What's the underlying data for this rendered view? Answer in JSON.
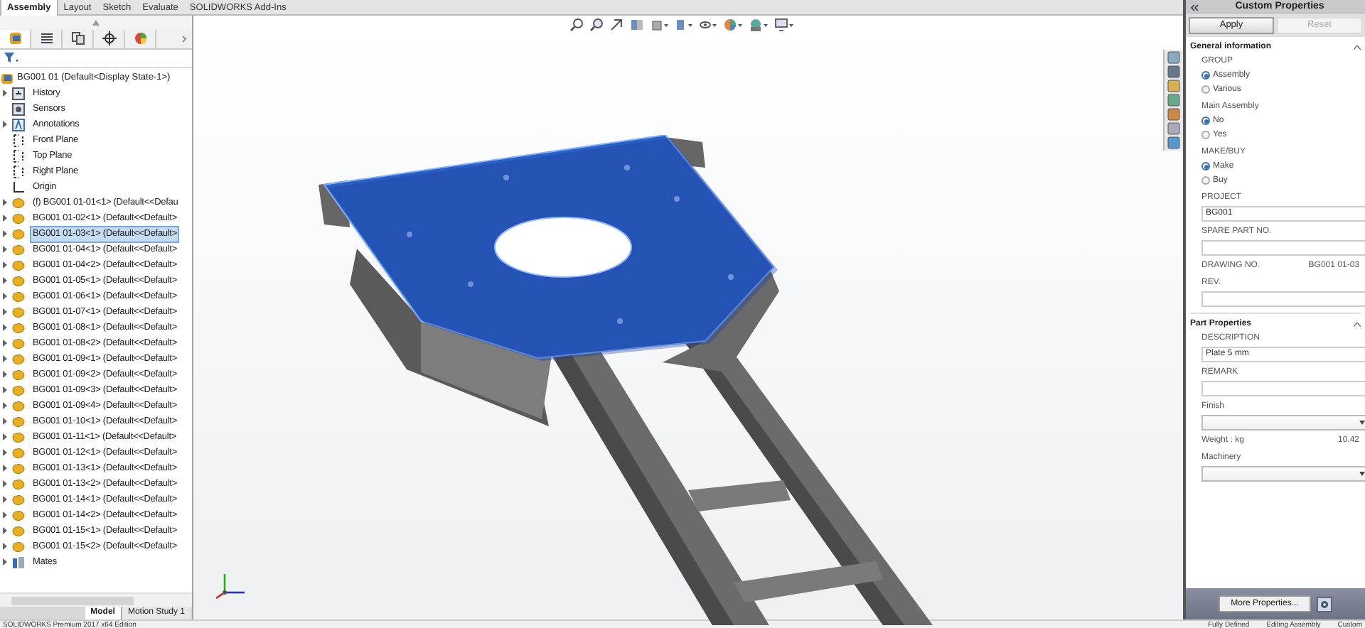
{
  "command_tabs": [
    {
      "label": "Assembly",
      "selected": true
    },
    {
      "label": "Layout",
      "selected": false
    },
    {
      "label": "Sketch",
      "selected": false
    },
    {
      "label": "Evaluate",
      "selected": false
    },
    {
      "label": "SOLIDWORKS Add-Ins",
      "selected": false
    }
  ],
  "tree": {
    "root": "BG001 01  (Default<Display State-1>)",
    "items": [
      {
        "label": "History",
        "kind": "history",
        "expandable": true,
        "selected": false
      },
      {
        "label": "Sensors",
        "kind": "sensors",
        "expandable": false,
        "selected": false
      },
      {
        "label": "Annotations",
        "kind": "annotations",
        "expandable": true,
        "selected": false
      },
      {
        "label": "Front Plane",
        "kind": "plane",
        "expandable": false,
        "selected": false
      },
      {
        "label": "Top Plane",
        "kind": "plane",
        "expandable": false,
        "selected": false
      },
      {
        "label": "Right Plane",
        "kind": "plane",
        "expandable": false,
        "selected": false
      },
      {
        "label": "Origin",
        "kind": "origin",
        "expandable": false,
        "selected": false
      },
      {
        "label": "(f) BG001 01-01<1> (Default<<Defau",
        "kind": "part",
        "expandable": true,
        "selected": false
      },
      {
        "label": "BG001 01-02<1> (Default<<Default>",
        "kind": "part",
        "expandable": true,
        "selected": false
      },
      {
        "label": "BG001 01-03<1> (Default<<Default>",
        "kind": "part",
        "expandable": true,
        "selected": true
      },
      {
        "label": "BG001 01-04<1> (Default<<Default>",
        "kind": "part",
        "expandable": true,
        "selected": false
      },
      {
        "label": "BG001 01-04<2> (Default<<Default>",
        "kind": "part",
        "expandable": true,
        "selected": false
      },
      {
        "label": "BG001 01-05<1> (Default<<Default>",
        "kind": "part",
        "expandable": true,
        "selected": false
      },
      {
        "label": "BG001 01-06<1> (Default<<Default>",
        "kind": "part",
        "expandable": true,
        "selected": false
      },
      {
        "label": "BG001 01-07<1> (Default<<Default>",
        "kind": "part",
        "expandable": true,
        "selected": false
      },
      {
        "label": "BG001 01-08<1> (Default<<Default>",
        "kind": "part",
        "expandable": true,
        "selected": false
      },
      {
        "label": "BG001 01-08<2> (Default<<Default>",
        "kind": "part",
        "expandable": true,
        "selected": false
      },
      {
        "label": "BG001 01-09<1> (Default<<Default>",
        "kind": "part",
        "expandable": true,
        "selected": false
      },
      {
        "label": "BG001 01-09<2> (Default<<Default>",
        "kind": "part",
        "expandable": true,
        "selected": false
      },
      {
        "label": "BG001 01-09<3> (Default<<Default>",
        "kind": "part",
        "expandable": true,
        "selected": false
      },
      {
        "label": "BG001 01-09<4> (Default<<Default>",
        "kind": "part",
        "expandable": true,
        "selected": false
      },
      {
        "label": "BG001 01-10<1> (Default<<Default>",
        "kind": "part",
        "expandable": true,
        "selected": false
      },
      {
        "label": "BG001 01-11<1> (Default<<Default>",
        "kind": "part",
        "expandable": true,
        "selected": false
      },
      {
        "label": "BG001 01-12<1> (Default<<Default>",
        "kind": "part",
        "expandable": true,
        "selected": false
      },
      {
        "label": "BG001 01-13<1> (Default<<Default>",
        "kind": "part",
        "expandable": true,
        "selected": false
      },
      {
        "label": "BG001 01-13<2> (Default<<Default>",
        "kind": "part",
        "expandable": true,
        "selected": false
      },
      {
        "label": "BG001 01-14<1> (Default<<Default>",
        "kind": "part",
        "expandable": true,
        "selected": false
      },
      {
        "label": "BG001 01-14<2> (Default<<Default>",
        "kind": "part",
        "expandable": true,
        "selected": false
      },
      {
        "label": "BG001 01-15<1> (Default<<Default>",
        "kind": "part",
        "expandable": true,
        "selected": false
      },
      {
        "label": "BG001 01-15<2> (Default<<Default>",
        "kind": "part",
        "expandable": true,
        "selected": false
      },
      {
        "label": "Mates",
        "kind": "mates",
        "expandable": true,
        "selected": false
      }
    ]
  },
  "bottom_tabs": [
    {
      "label": "Model",
      "selected": true
    },
    {
      "label": "Motion Study 1",
      "selected": false
    }
  ],
  "custom_properties": {
    "title": "Custom Properties",
    "buttons": [
      {
        "label": "Apply",
        "disabled": false
      },
      {
        "label": "Reset",
        "disabled": true
      }
    ],
    "sections": [
      {
        "title": "General information",
        "fields": [
          {
            "kind": "radio",
            "label": "GROUP",
            "options": [
              {
                "label": "Assembly",
                "selected": true
              },
              {
                "label": "Various",
                "selected": false
              }
            ]
          },
          {
            "kind": "radio",
            "label": "Main Assembly",
            "options": [
              {
                "label": "No",
                "selected": true
              },
              {
                "label": "Yes",
                "selected": false
              }
            ]
          },
          {
            "kind": "radio",
            "label": "MAKE/BUY",
            "options": [
              {
                "label": "Make",
                "selected": true
              },
              {
                "label": "Buy",
                "selected": false
              }
            ]
          },
          {
            "kind": "text",
            "label": "PROJECT",
            "value": "BG001"
          },
          {
            "kind": "text",
            "label": "SPARE PART NO."
          },
          {
            "kind": "readonly",
            "label": "DRAWING NO.",
            "value": "BG001 01-03"
          },
          {
            "kind": "text",
            "label": "REV."
          }
        ]
      },
      {
        "title": "Part Properties",
        "fields": [
          {
            "kind": "text",
            "label": "DESCRIPTION",
            "value": "Plate 5 mm"
          },
          {
            "kind": "text",
            "label": "REMARK"
          },
          {
            "kind": "dropdown",
            "label": "Finish"
          },
          {
            "kind": "readonly",
            "label": "Weight : kg",
            "value": "10.42"
          },
          {
            "kind": "dropdown",
            "label": "Machinery"
          }
        ]
      }
    ],
    "more_button": "More Properties..."
  },
  "status_bar": [
    "SOLIDWORKS Premium 2017 x64 Edition",
    "Fully Defined",
    "Editing Assembly",
    "Custom"
  ]
}
